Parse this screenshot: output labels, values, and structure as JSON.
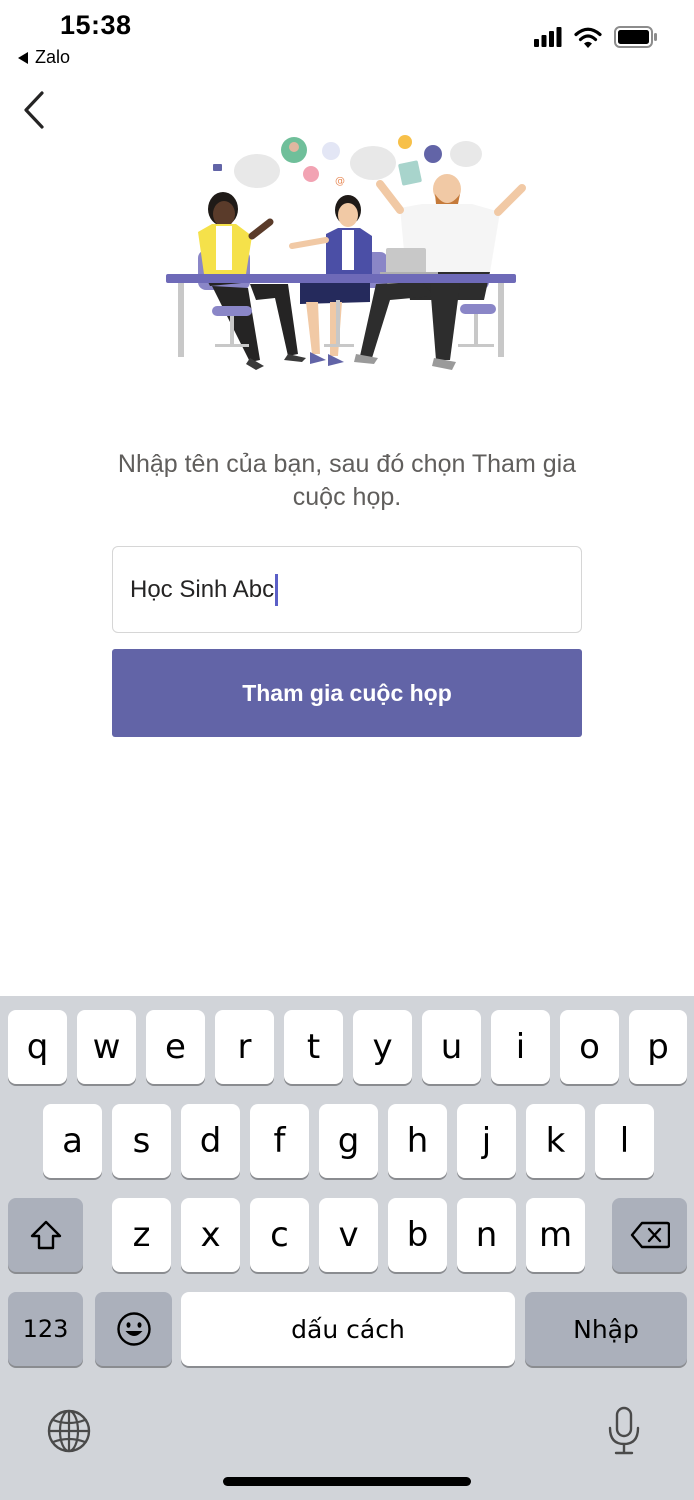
{
  "status_bar": {
    "time": "15:38",
    "back_app": "Zalo",
    "signal_icon": "cellular-signal-icon",
    "wifi_icon": "wifi-icon",
    "battery_icon": "battery-icon"
  },
  "nav": {
    "back_icon": "chevron-left-icon"
  },
  "prompt": "Nhập tên của bạn, sau đó chọn Tham gia cuộc họp.",
  "name_input": {
    "value": "Học Sinh Abc"
  },
  "join_button": {
    "label": "Tham gia cuộc họp"
  },
  "keyboard": {
    "row1": [
      "q",
      "w",
      "e",
      "r",
      "t",
      "y",
      "u",
      "i",
      "o",
      "p"
    ],
    "row2": [
      "a",
      "s",
      "d",
      "f",
      "g",
      "h",
      "j",
      "k",
      "l"
    ],
    "row3": [
      "z",
      "x",
      "c",
      "v",
      "b",
      "n",
      "m"
    ],
    "numbers_label": "123",
    "space_label": "dấu cách",
    "return_label": "Nhập",
    "shift_icon": "shift-icon",
    "delete_icon": "backspace-icon",
    "emoji_icon": "emoji-icon",
    "globe_icon": "globe-icon",
    "mic_icon": "microphone-icon"
  },
  "colors": {
    "accent": "#6264a7",
    "keyboard_bg": "#d1d4d9",
    "key_bg": "#ffffff",
    "key_dark_bg": "#abb0bb"
  }
}
